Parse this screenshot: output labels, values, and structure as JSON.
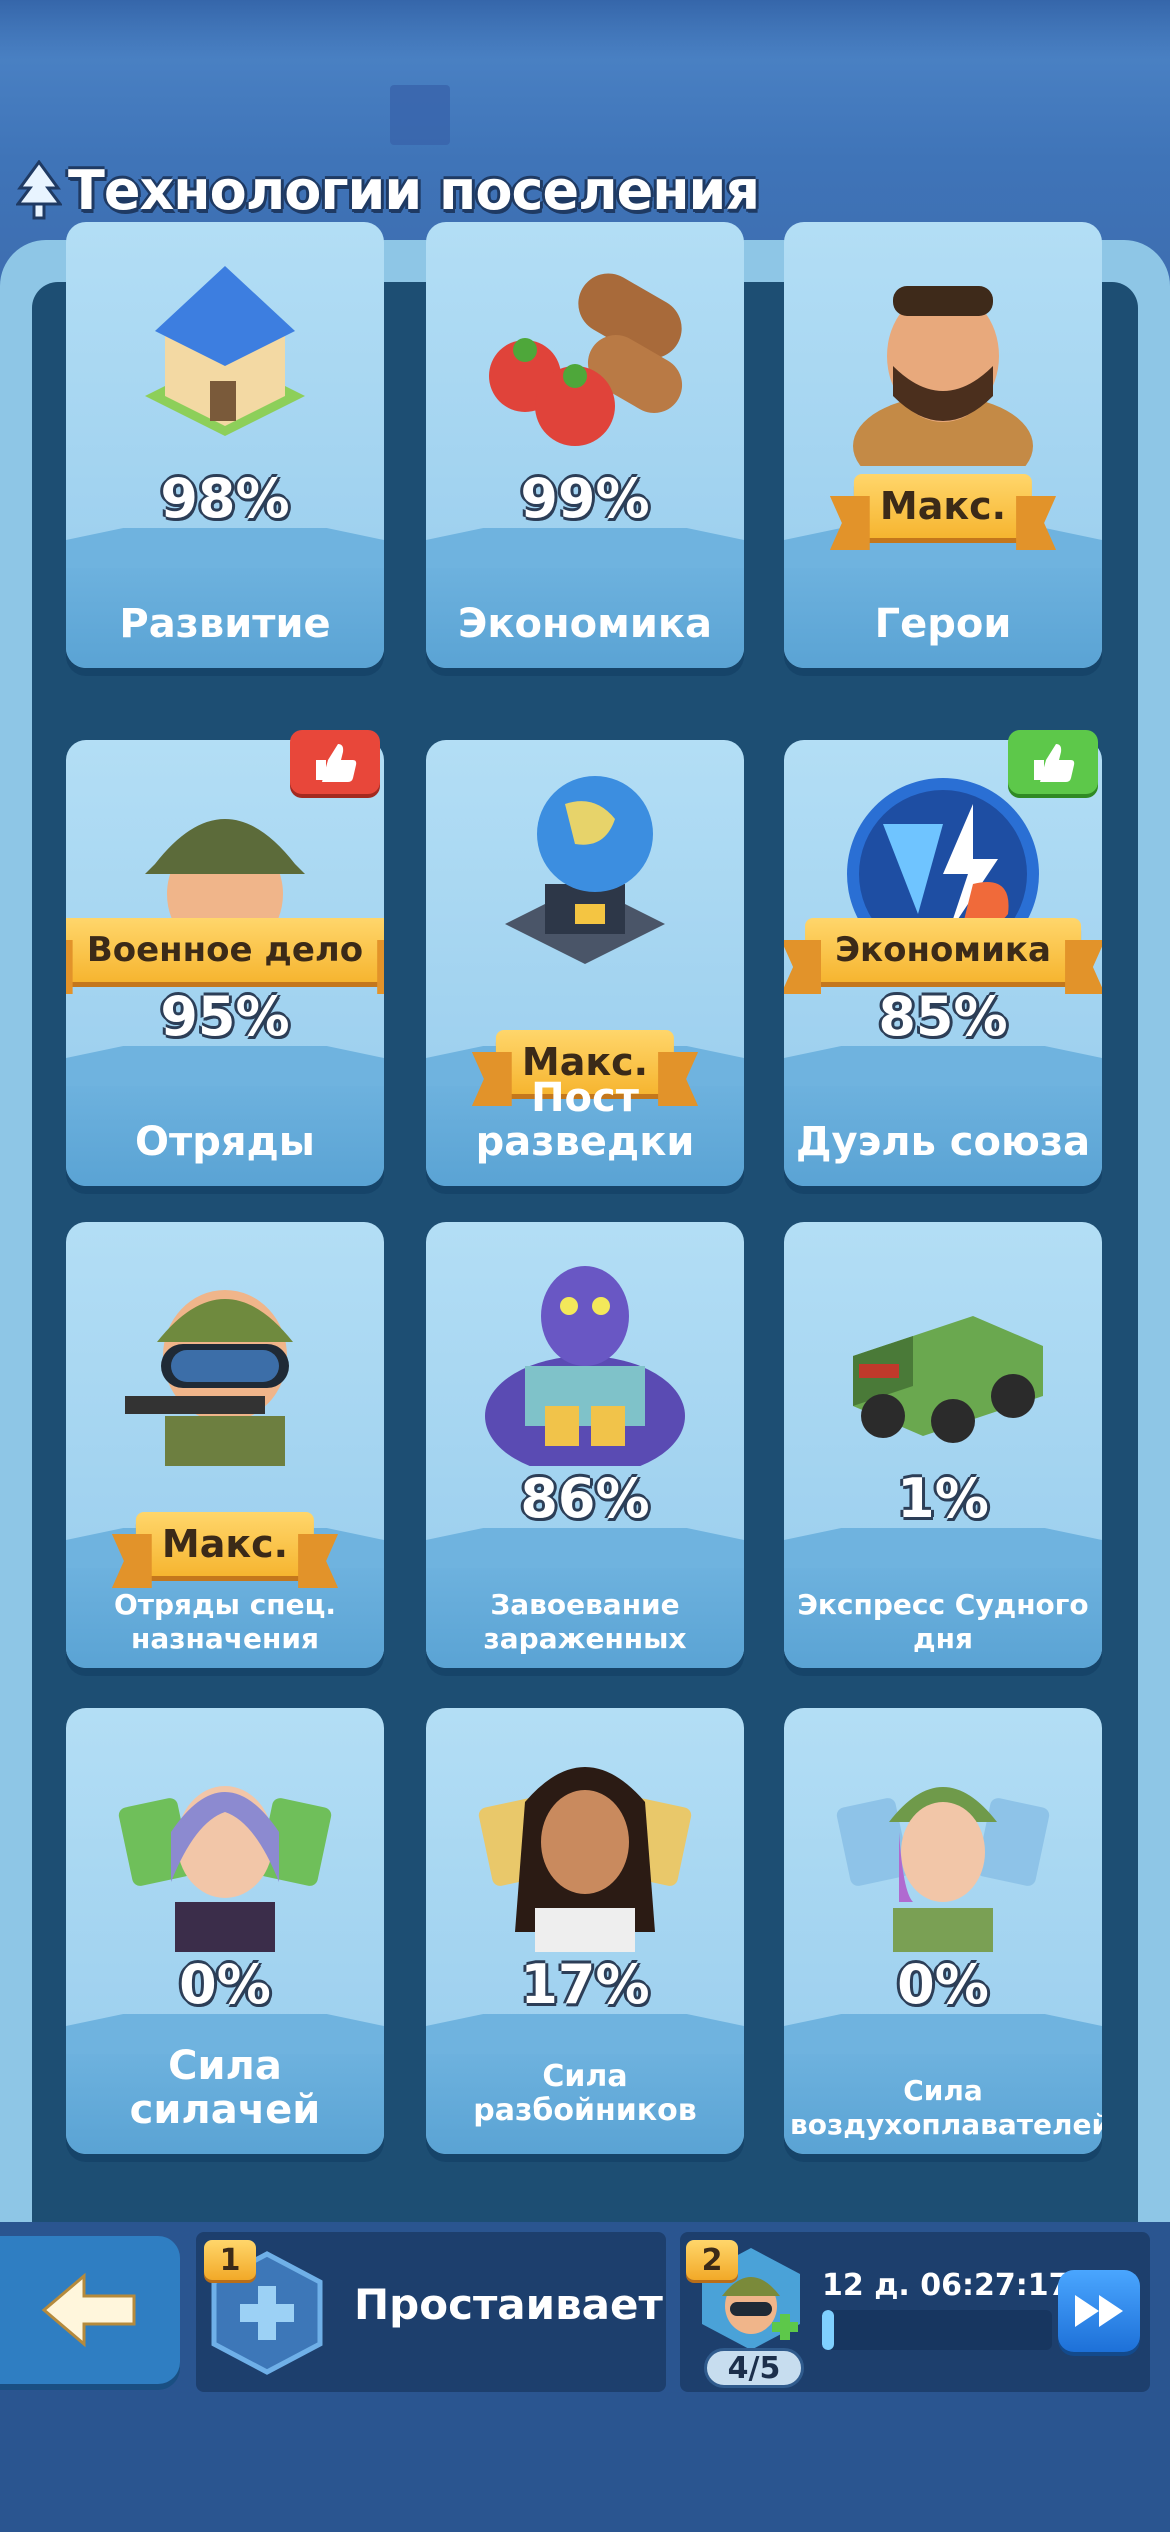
{
  "header": {
    "title": "Технологии поселения",
    "icon": "tree-icon"
  },
  "cards": [
    {
      "name": "Развитие",
      "percent": "98%",
      "ribbon": "",
      "icon": "house-icon",
      "recommended": ""
    },
    {
      "name": "Экономика",
      "percent": "99%",
      "ribbon": "",
      "icon": "food-logs-icon",
      "recommended": ""
    },
    {
      "name": "Герои",
      "percent": "",
      "ribbon": "Макс.",
      "icon": "hero-portrait-icon",
      "recommended": ""
    },
    {
      "name": "Отряды",
      "percent": "95%",
      "ribbon": "Военное дело",
      "icon": "soldier-helmet-icon",
      "recommended": "red"
    },
    {
      "name": "Пост разведки",
      "percent": "",
      "ribbon": "Макс.",
      "icon": "radar-globe-icon",
      "recommended": ""
    },
    {
      "name": "Дуэль союза",
      "percent": "85%",
      "ribbon": "Экономика",
      "icon": "vs-icon",
      "recommended": "green"
    },
    {
      "name": "Отряды спец. назначения",
      "percent": "",
      "ribbon": "Макс.",
      "icon": "special-forces-icon",
      "recommended": ""
    },
    {
      "name": "Завоевание зараженных",
      "percent": "86%",
      "ribbon": "",
      "icon": "zombie-icon",
      "recommended": ""
    },
    {
      "name": "Экспресс Судного дня",
      "percent": "1%",
      "ribbon": "",
      "icon": "armored-truck-icon",
      "recommended": ""
    },
    {
      "name": "Сила силачей",
      "percent": "0%",
      "ribbon": "",
      "icon": "bruiser-portrait-icon",
      "recommended": ""
    },
    {
      "name": "Сила разбойников",
      "percent": "17%",
      "ribbon": "",
      "icon": "marauder-portrait-icon",
      "recommended": ""
    },
    {
      "name": "Сила воздухоплавателей",
      "percent": "0%",
      "ribbon": "",
      "icon": "aviator-portrait-icon",
      "recommended": ""
    }
  ],
  "bottom": {
    "back_icon": "back-arrow-icon",
    "slot1": {
      "number": "1",
      "label": "Простаивает",
      "icon": "plus-hex-icon"
    },
    "slot2": {
      "number": "2",
      "timer": "12 д. 06:27:17",
      "count": "4/5",
      "progress": 0.05,
      "icon": "builder-avatar-icon"
    },
    "skip_icon": "fast-forward-icon"
  },
  "colors": {
    "panel": "#1d4e73",
    "card": "#9fd1ef",
    "ribbon": "#f6b530",
    "accent_red": "#e8473a",
    "accent_green": "#5dc84a"
  }
}
